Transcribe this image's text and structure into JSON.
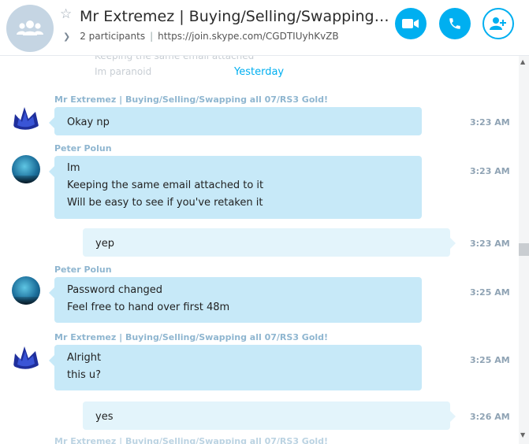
{
  "header": {
    "title": "Mr Extremez | Buying/Selling/Swapping…",
    "participants": "2 participants",
    "link": "https://join.skype.com/CGDTIUyhKvZB"
  },
  "chat": {
    "ghost_lines": [
      "Keeping the same email attached",
      "Im paranoid"
    ],
    "day_divider": "Yesterday",
    "messages": [
      {
        "sender": "Mr Extremez | Buying/Selling/Swapping all 07/RS3 Gold!",
        "lines": [
          "Okay np"
        ],
        "time": "3:23 AM"
      },
      {
        "sender": "Peter Polun",
        "lines": [
          "Im",
          "Keeping the same email attached to it",
          "Will be easy to see if you've retaken it"
        ],
        "time": "3:23 AM"
      },
      {
        "lines": [
          "yep"
        ],
        "time": "3:23 AM"
      },
      {
        "sender": "Peter Polun",
        "lines": [
          "Password changed",
          "Feel free to hand over first 48m"
        ],
        "time": "3:25 AM"
      },
      {
        "sender": "Mr Extremez | Buying/Selling/Swapping all 07/RS3 Gold!",
        "lines": [
          "Alright",
          "this u?"
        ],
        "time": "3:25 AM"
      },
      {
        "lines": [
          "yes"
        ],
        "time": "3:26 AM"
      },
      {
        "sender": "Mr Extremez | Buying/Selling/Swapping all 07/RS3 Gold!"
      }
    ]
  },
  "colors": {
    "accent": "#00aff0",
    "incoming_bubble": "#c7e9f8",
    "outgoing_bubble": "#e3f4fb"
  }
}
